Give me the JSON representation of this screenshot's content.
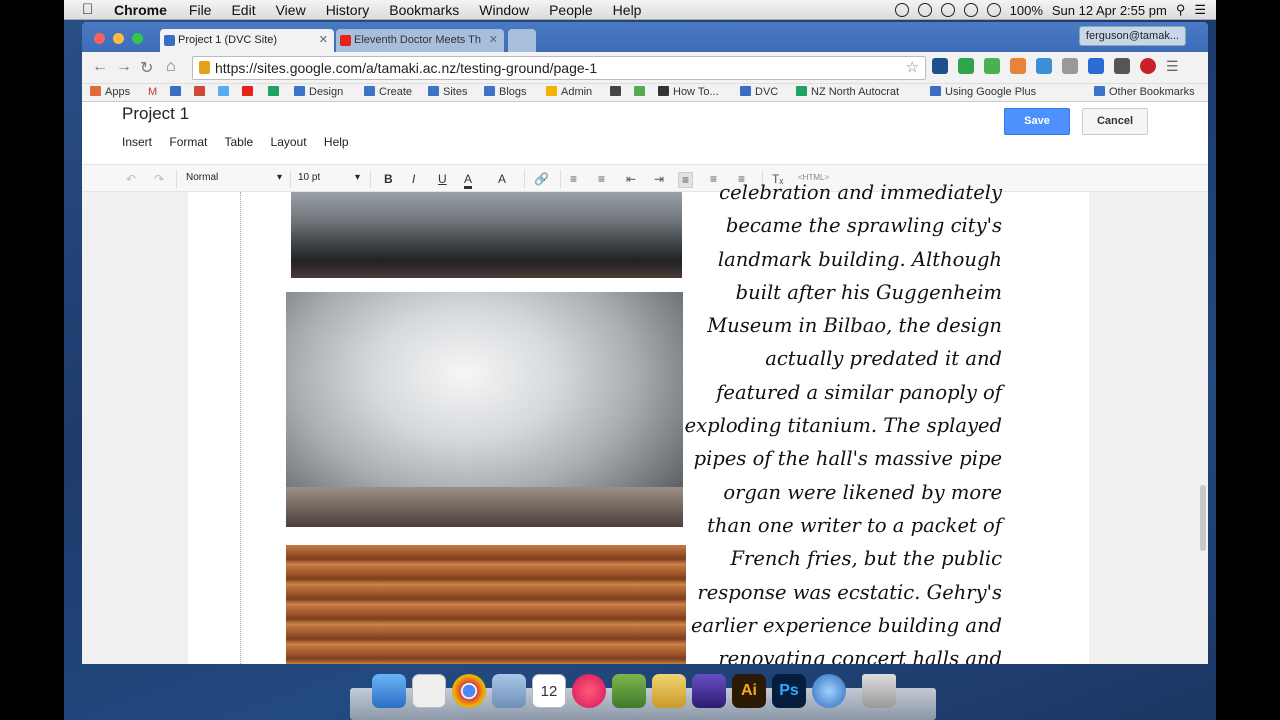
{
  "menubar": {
    "app": "Chrome",
    "items": [
      "File",
      "Edit",
      "View",
      "History",
      "Bookmarks",
      "Window",
      "People",
      "Help"
    ],
    "battery": "100%",
    "clock": "Sun 12 Apr  2:55 pm"
  },
  "browser": {
    "tabs": [
      {
        "title": "Project 1 (DVC Site)",
        "active": true
      },
      {
        "title": "Eleventh Doctor Meets Th",
        "active": false
      }
    ],
    "profile": "ferguson@tamak...",
    "url": "https://sites.google.com/a/tamaki.ac.nz/testing-ground/page-1",
    "bookmarks": [
      "Apps",
      "Design",
      "Create",
      "Sites",
      "Blogs",
      "Admin",
      "How To...",
      "DVC",
      "NZ North Autocrat",
      "Using Google Plus",
      "Other Bookmarks"
    ]
  },
  "editor": {
    "page_title": "Project 1",
    "menu": [
      "Insert",
      "Format",
      "Table",
      "Layout",
      "Help"
    ],
    "save_label": "Save",
    "cancel_label": "Cancel",
    "style_select": "Normal",
    "size_select": "10 pt",
    "html_label": "<HTML>"
  },
  "article": {
    "lines": [
      "celebration and immediately",
      "became the sprawling city's",
      "landmark building. Although",
      "built after his Guggenheim",
      "Museum in Bilbao, the design",
      "actually predated it and",
      "featured a similar panoply of",
      "exploding titanium. The splayed",
      "pipes of the hall's massive pipe",
      "organ were likened by more",
      "than one writer to a packet of",
      "French fries, but the public",
      "response was ecstatic. Gehry's",
      "earlier experience building and",
      "renovating concert halls and"
    ]
  }
}
